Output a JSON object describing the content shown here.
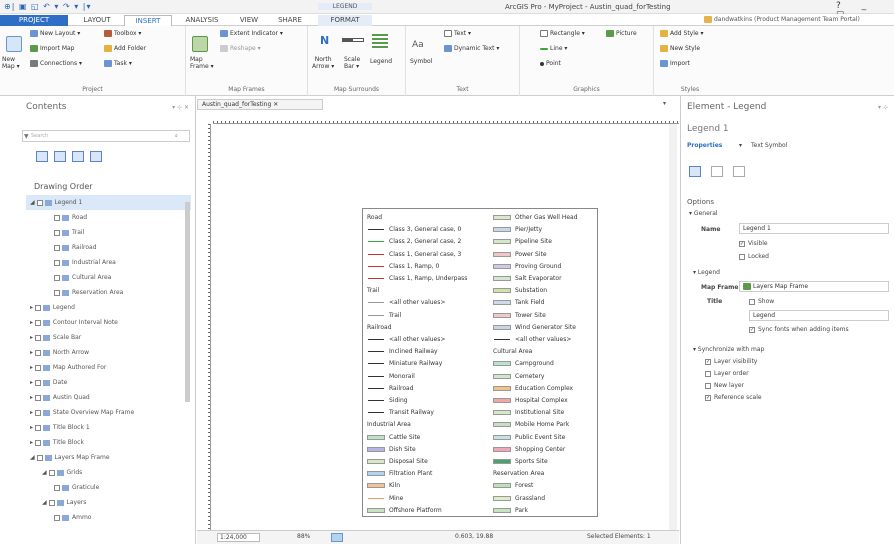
{
  "titlebar": {
    "qat": "⊕| ▣ ◱ ↶ ▾ ↷ ▾ |▾",
    "context_tab": "LEGEND",
    "title": "ArcGIS Pro - MyProject - Austin_quad_forTesting",
    "controls": "?  _  ☐"
  },
  "tabs": [
    "PROJECT",
    "LAYOUT",
    "INSERT",
    "ANALYSIS",
    "VIEW",
    "SHARE",
    "FORMAT"
  ],
  "user": "dandwatkins (Product Management Team Portal)",
  "ribbon": {
    "project": {
      "new_layout": "New Layout ▾",
      "toolbox": "Toolbox ▾",
      "new_map": "New\nMap ▾",
      "import_map": "Import Map",
      "add_folder": "Add Folder",
      "connections": "Connections ▾",
      "task": "Task ▾",
      "label": "Project"
    },
    "map_frames": {
      "map_frame": "Map\nFrame ▾",
      "extent_indicator": "Extent Indicator ▾",
      "reshape": "Reshape ▾",
      "label": "Map Frames"
    },
    "map_surrounds": {
      "north_arrow": "North\nArrow ▾",
      "scale_bar": "Scale\nBar ▾",
      "legend": "Legend",
      "label": "Map Surrounds"
    },
    "text": {
      "symbol": "Symbol",
      "text": "Text ▾",
      "dynamic_text": "Dynamic Text ▾",
      "label": "Text"
    },
    "graphics": {
      "rectangle": "Rectangle ▾",
      "picture": "Picture",
      "line": "Line ▾",
      "point": "Point",
      "label": "Graphics"
    },
    "styles": {
      "add_style": "Add Style ▾",
      "new_style": "New Style",
      "import": "Import",
      "label": "Styles"
    }
  },
  "contents": {
    "title": "Contents",
    "pin": "▾ ⊹ ✕",
    "search_placeholder": "Search",
    "draw_order": "Drawing Order",
    "items": [
      "Legend 1",
      "Road",
      "Trail",
      "Railroad",
      "Industrial Area",
      "Cultural Area",
      "Reservation Area",
      "Legend",
      "Contour Interval Note",
      "Scale Bar",
      "North Arrow",
      "Map Authored For",
      "Date",
      "Austin Quad",
      "State Overview Map Frame",
      "Title Block 1",
      "Title Block",
      "Layers Map Frame",
      "Grids",
      "Graticule",
      "Layers",
      "Ammo"
    ]
  },
  "doc_tab": "Austin_quad_forTesting  ✕",
  "legend": {
    "col1": [
      {
        "t": "h",
        "l": "Road"
      },
      {
        "t": "l",
        "l": "Class 3, General case, 0",
        "c": "#333333"
      },
      {
        "t": "l",
        "l": "Class 2, General case, 2",
        "c": "#3aa83a"
      },
      {
        "t": "l",
        "l": "Class 1, General case, 3",
        "c": "#c83232"
      },
      {
        "t": "l",
        "l": "Class 1, Ramp, 0",
        "c": "#c83232"
      },
      {
        "t": "l",
        "l": "Class 1, Ramp, Underpass",
        "c": "#c83232"
      },
      {
        "t": "h",
        "l": "Trail"
      },
      {
        "t": "l",
        "l": "<all other values>",
        "c": "#999999"
      },
      {
        "t": "l",
        "l": "Trail",
        "c": "#999999"
      },
      {
        "t": "h",
        "l": "Railroad"
      },
      {
        "t": "l",
        "l": "<all other values>",
        "c": "#333333"
      },
      {
        "t": "l",
        "l": "Inclined Railway",
        "c": "#333333"
      },
      {
        "t": "l",
        "l": "Miniature Railway",
        "c": "#333333"
      },
      {
        "t": "l",
        "l": "Monorail",
        "c": "#333333"
      },
      {
        "t": "l",
        "l": "Railroad",
        "c": "#333333"
      },
      {
        "t": "l",
        "l": "Siding",
        "c": "#333333"
      },
      {
        "t": "l",
        "l": "Transit Railway",
        "c": "#333333"
      },
      {
        "t": "h",
        "l": "Industrial Area"
      },
      {
        "t": "s",
        "l": "Cattle Site",
        "c": "#bfe3c6"
      },
      {
        "t": "s",
        "l": "Dish Site",
        "c": "#b8b4e6"
      },
      {
        "t": "s",
        "l": "Disposal Site",
        "c": "#d7e9c2"
      },
      {
        "t": "s",
        "l": "Filtration Plant",
        "c": "#b3d4ef"
      },
      {
        "t": "s",
        "l": "Kiln",
        "c": "#f0c39a"
      },
      {
        "t": "l",
        "l": "Mine",
        "c": "#e3a06a"
      },
      {
        "t": "s",
        "l": "Offshore Platform",
        "c": "#c6e2c2"
      }
    ],
    "col2": [
      {
        "t": "s",
        "l": "Other Gas Well Head",
        "c": "#d8e9c6"
      },
      {
        "t": "s",
        "l": "Pier/Jetty",
        "c": "#c6d9ea"
      },
      {
        "t": "s",
        "l": "Pipeline Site",
        "c": "#d3e8c6"
      },
      {
        "t": "s",
        "l": "Power Site",
        "c": "#f2c4cc"
      },
      {
        "t": "s",
        "l": "Proving Ground",
        "c": "#cbcbe8"
      },
      {
        "t": "s",
        "l": "Salt Evaporator",
        "c": "#d5e6d1"
      },
      {
        "t": "s",
        "l": "Substation",
        "c": "#cfe4a6"
      },
      {
        "t": "s",
        "l": "Tank Field",
        "c": "#ced9ec"
      },
      {
        "t": "s",
        "l": "Tower Site",
        "c": "#f0c9c9"
      },
      {
        "t": "s",
        "l": "Wind Generator Site",
        "c": "#c9d3ea"
      },
      {
        "t": "l",
        "l": "<all other values>",
        "c": "#333333"
      },
      {
        "t": "h",
        "l": "Cultural Area"
      },
      {
        "t": "s",
        "l": "Campground",
        "c": "#b9e2cf"
      },
      {
        "t": "s",
        "l": "Cemetery",
        "c": "#cfe6c8"
      },
      {
        "t": "s",
        "l": "Education Complex",
        "c": "#f2c481"
      },
      {
        "t": "s",
        "l": "Hospital Complex",
        "c": "#f1a6a6"
      },
      {
        "t": "s",
        "l": "Institutional Site",
        "c": "#d6e8c9"
      },
      {
        "t": "s",
        "l": "Mobile Home Park",
        "c": "#c6e0c6"
      },
      {
        "t": "s",
        "l": "Public Event Site",
        "c": "#c5e1e3"
      },
      {
        "t": "s",
        "l": "Shopping Center",
        "c": "#f2a7b8"
      },
      {
        "t": "s",
        "l": "Sports Site",
        "c": "#47a56b"
      },
      {
        "t": "h",
        "l": "Reservation Area"
      },
      {
        "t": "s",
        "l": "Forest",
        "c": "#bfe0b7"
      },
      {
        "t": "s",
        "l": "Grassland",
        "c": "#ddeec6"
      },
      {
        "t": "s",
        "l": "Park",
        "c": "#c7e4c1"
      }
    ]
  },
  "status": {
    "scale": "1:24,000",
    "zoom": "88%",
    "coords": "0.603, 19.88",
    "selected": "Selected Elements: 1"
  },
  "element_pane": {
    "title": "Element - Legend",
    "pin": "▾ ⊹",
    "object_name": "Legend 1",
    "tab_properties": "Properties",
    "tab_text_symbol": "Text Symbol",
    "options": "Options",
    "general": "General",
    "name_label": "Name",
    "name_value": "Legend 1",
    "visible": "Visible",
    "locked": "Locked",
    "legend_section": "Legend",
    "map_frame_label": "Map Frame",
    "map_frame_value": "Layers Map Frame",
    "title_label": "Title",
    "show": "Show",
    "title_value": "Legend",
    "sync_fonts": "Sync fonts when adding items",
    "sync_section": "Synchronize with map",
    "layer_visibility": "Layer visibility",
    "layer_order": "Layer order",
    "new_layer": "New layer",
    "reference_scale": "Reference scale"
  },
  "colors": {
    "accent": "#2e6ec4",
    "selected": "#dbe8f8"
  }
}
